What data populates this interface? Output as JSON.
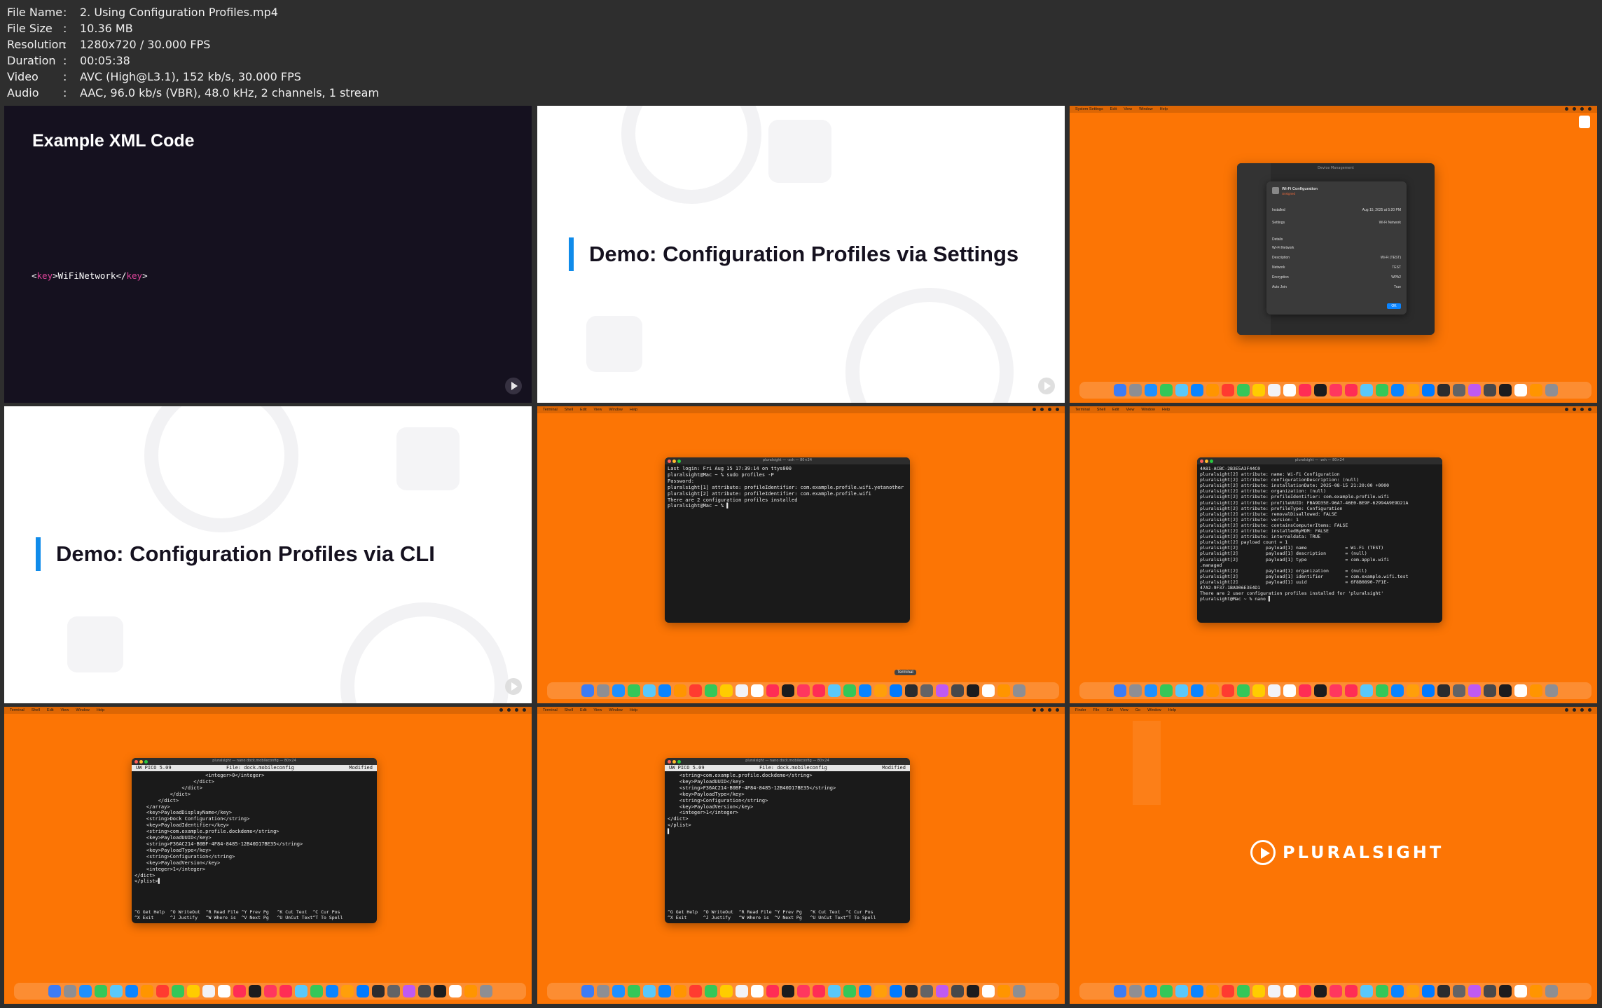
{
  "file_info": [
    {
      "key": "File Name",
      "sep": ":",
      "value": "2. Using Configuration Profiles.mp4"
    },
    {
      "key": "File Size",
      "sep": ":",
      "value": "10.36 MB"
    },
    {
      "key": "Resolution",
      "sep": ":",
      "value": "1280x720 / 30.000 FPS"
    },
    {
      "key": "Duration",
      "sep": ":",
      "value": "00:05:38"
    },
    {
      "key": "Video",
      "sep": ":",
      "value": "AVC (High@L3.1), 152 kb/s, 30.000 FPS"
    },
    {
      "key": "Audio",
      "sep": ":",
      "value": "AAC, 96.0 kb/s (VBR), 48.0 kHz, 2 channels, 1 stream"
    }
  ],
  "tile1": {
    "title": "Example XML Code",
    "xml_open": "<",
    "xml_tag1": "key",
    "xml_close1": ">",
    "xml_value": "WiFiNetwork",
    "xml_open2": "</",
    "xml_tag2": "key",
    "xml_close2": ">"
  },
  "tile2": {
    "title": "Demo: Configuration Profiles via Settings"
  },
  "tile3": {
    "menubar": [
      "System Settings",
      "Edit",
      "View",
      "Window",
      "Help"
    ],
    "window_title": "Device Management",
    "sheet_title": "Wi-Fi Configuration",
    "sheet_subtitle": "Unsigned",
    "rows": [
      {
        "label": "Installed",
        "value": "Aug 15, 2025 at 5:20 PM"
      },
      {
        "label": "Settings",
        "value": "Wi-Fi Network"
      },
      {
        "label": "Details",
        "value": ""
      },
      {
        "label": "Wi-Fi Network",
        "value": ""
      },
      {
        "label": "Description",
        "value": "Wi-Fi (TEST)"
      },
      {
        "label": "Network",
        "value": "TEST"
      },
      {
        "label": "Encryption",
        "value": "WPA2"
      },
      {
        "label": "Auto Join",
        "value": "True"
      }
    ],
    "ok_label": "OK"
  },
  "tile4": {
    "title": "Demo: Configuration Profiles via CLI"
  },
  "tile5": {
    "menubar": [
      "Terminal",
      "Shell",
      "Edit",
      "View",
      "Window",
      "Help"
    ],
    "window_title": "pluralsight — -zsh — 80×24",
    "lines": [
      "Last login: Fri Aug 15 17:39:14 on ttys000",
      "pluralsight@Mac ~ % sudo profiles -P",
      "Password:",
      "pluralsight[1] attribute: profileIdentifier: com.example.profile.wifi.yetanother",
      "pluralsight[2] attribute: profileIdentifier: com.example.profile.wifi",
      "There are 2 configuration profiles installed",
      "pluralsight@Mac ~ % ▌"
    ],
    "tooltip": "Terminal"
  },
  "tile6": {
    "menubar": [
      "Terminal",
      "Shell",
      "Edit",
      "View",
      "Window",
      "Help"
    ],
    "window_title": "pluralsight — -zsh — 80×24",
    "lines": [
      "4A81-ACBC-2B3E5A3F44C0",
      "pluralsight[2] attribute: name: Wi-Fi Configuration",
      "pluralsight[2] attribute: configurationDescription: (null)",
      "pluralsight[2] attribute: installationDate: 2025-08-15 21:20:00 +0000",
      "pluralsight[2] attribute: organization: (null)",
      "pluralsight[2] attribute: profileIdentifier: com.example.profile.wifi",
      "pluralsight[2] attribute: profileUUID: FBA9D35E-96A7-46E0-BE9F-62994A9E9D21A",
      "pluralsight[2] attribute: profileType: Configuration",
      "pluralsight[2] attribute: removalDisallowed: FALSE",
      "pluralsight[2] attribute: version: 1",
      "pluralsight[2] attribute: containsComputerItems: FALSE",
      "pluralsight[2] attribute: installedByMDM: FALSE",
      "pluralsight[2] attribute: internaldata: TRUE",
      "pluralsight[2] payload count = 1",
      "pluralsight[2]          payload[1] name              = Wi-Fi (TEST)",
      "pluralsight[2]          payload[1] description       = (null)",
      "pluralsight[2]          payload[1] type              = com.apple.wifi",
      ".managed",
      "pluralsight[2]          payload[1] organization      = (null)",
      "pluralsight[2]          payload[1] identifier        = com.example.wifi.test",
      "pluralsight[2]          payload[1] uuid              = 6F8B0890-7F1E-",
      "47A2-9F37-1BA906E3E4D1",
      "There are 2 user configuration profiles installed for 'pluralsight'",
      "pluralsight@Mac ~ % nano ▌"
    ]
  },
  "tile7": {
    "menubar": [
      "Terminal",
      "Shell",
      "Edit",
      "View",
      "Window",
      "Help"
    ],
    "window_title": "pluralsight — nano dock.mobileconfig — 80×24",
    "nano_version": "UW PICO 5.09",
    "nano_file": "File: dock.mobileconfig",
    "nano_status": "Modified",
    "lines": [
      "                        <integer>0</integer>",
      "                    </dict>",
      "                </dict>",
      "            </dict>",
      "        </dict>",
      "    </array>",
      "    <key>PayloadDisplayName</key>",
      "    <string>Dock Configuration</string>",
      "    <key>PayloadIdentifier</key>",
      "    <string>com.example.profile.dockdemo</string>",
      "    <key>PayloadUUID</key>",
      "    <string>F36AC214-B0BF-4F84-8485-12B40D17BE35</string>",
      "    <key>PayloadType</key>",
      "    <string>Configuration</string>",
      "    <key>PayloadVersion</key>",
      "    <integer>1</integer>",
      "</dict>",
      "</plist>▌"
    ],
    "footer": [
      "^G Get Help  ^O WriteOut  ^R Read File ^Y Prev Pg   ^K Cut Text  ^C Cur Pos",
      "^X Exit      ^J Justify   ^W Where is  ^V Next Pg   ^U UnCut Text^T To Spell"
    ]
  },
  "tile8": {
    "menubar": [
      "Terminal",
      "Shell",
      "Edit",
      "View",
      "Window",
      "Help"
    ],
    "window_title": "pluralsight — nano dock.mobileconfig — 80×24",
    "nano_version": "UW PICO 5.09",
    "nano_file": "File: dock.mobileconfig",
    "nano_status": "Modified",
    "lines": [
      "    <string>com.example.profile.dockdemo</string>",
      "    <key>PayloadUUID</key>",
      "    <string>F36AC214-B0BF-4F84-8485-12B40D17BE35</string>",
      "    <key>PayloadType</key>",
      "    <string>Configuration</string>",
      "    <key>PayloadVersion</key>",
      "    <integer>1</integer>",
      "</dict>",
      "</plist>",
      "▌"
    ],
    "footer": [
      "^G Get Help  ^O WriteOut  ^R Read File ^Y Prev Pg   ^K Cut Text  ^C Cur Pos",
      "^X Exit      ^J Justify   ^W Where is  ^V Next Pg   ^U UnCut Text^T To Spell"
    ]
  },
  "tile9": {
    "menubar": [
      "Finder",
      "File",
      "Edit",
      "View",
      "Go",
      "Window",
      "Help"
    ],
    "logo_text": "PLURALSIGHT"
  },
  "colors": {
    "orange": "#fc7505",
    "dark_slide": "#15111f",
    "accent_blue": "#0f8bea",
    "xml_tag_pink": "#e0459c"
  }
}
